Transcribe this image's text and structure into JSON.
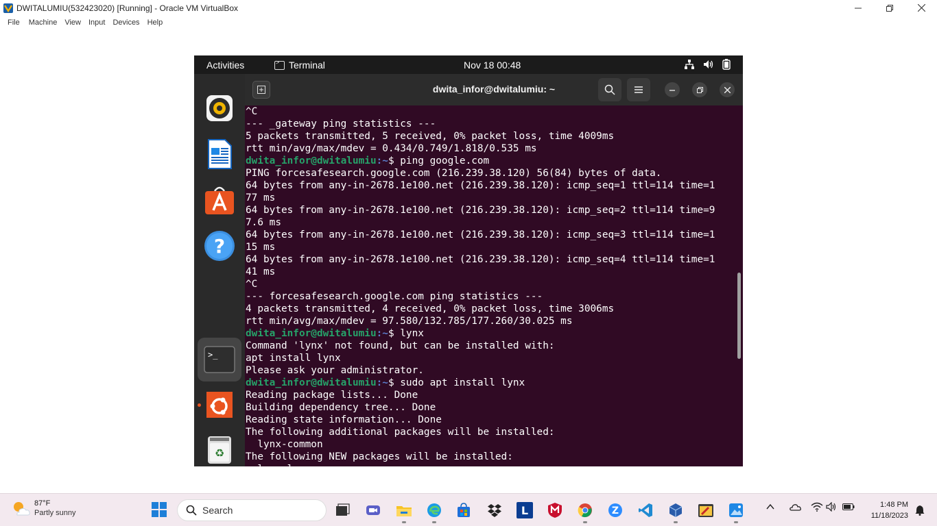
{
  "vbox": {
    "title": "DWITALUMIU(532423020) [Running] - Oracle VM VirtualBox",
    "menus": [
      "File",
      "Machine",
      "View",
      "Input",
      "Devices",
      "Help"
    ]
  },
  "guest": {
    "topbar": {
      "activities": "Activities",
      "app_name": "Terminal",
      "clock": "Nov 18  00:48"
    },
    "terminal": {
      "title": "dwita_infor@dwitalumiu: ~",
      "lines": [
        {
          "text": "^C"
        },
        {
          "text": "--- _gateway ping statistics ---"
        },
        {
          "text": "5 packets transmitted, 5 received, 0% packet loss, time 4009ms"
        },
        {
          "text": "rtt min/avg/max/mdev = 0.434/0.749/1.818/0.535 ms"
        },
        {
          "user": "dwita_infor@dwitalumiu",
          "path": ":~",
          "cmd": "$ ping google.com"
        },
        {
          "text": "PING forcesafesearch.google.com (216.239.38.120) 56(84) bytes of data."
        },
        {
          "text": "64 bytes from any-in-2678.1e100.net (216.239.38.120): icmp_seq=1 ttl=114 time=1"
        },
        {
          "text": "77 ms"
        },
        {
          "text": "64 bytes from any-in-2678.1e100.net (216.239.38.120): icmp_seq=2 ttl=114 time=9"
        },
        {
          "text": "7.6 ms"
        },
        {
          "text": "64 bytes from any-in-2678.1e100.net (216.239.38.120): icmp_seq=3 ttl=114 time=1"
        },
        {
          "text": "15 ms"
        },
        {
          "text": "64 bytes from any-in-2678.1e100.net (216.239.38.120): icmp_seq=4 ttl=114 time=1"
        },
        {
          "text": "41 ms"
        },
        {
          "text": "^C"
        },
        {
          "text": "--- forcesafesearch.google.com ping statistics ---"
        },
        {
          "text": "4 packets transmitted, 4 received, 0% packet loss, time 3006ms"
        },
        {
          "text": "rtt min/avg/max/mdev = 97.580/132.785/177.260/30.025 ms"
        },
        {
          "user": "dwita_infor@dwitalumiu",
          "path": ":~",
          "cmd": "$ lynx"
        },
        {
          "text": "Command 'lynx' not found, but can be installed with:"
        },
        {
          "text": "apt install lynx"
        },
        {
          "text": "Please ask your administrator."
        },
        {
          "user": "dwita_infor@dwitalumiu",
          "path": ":~",
          "cmd": "$ sudo apt install lynx"
        },
        {
          "text": "Reading package lists... Done"
        },
        {
          "text": "Building dependency tree... Done"
        },
        {
          "text": "Reading state information... Done"
        },
        {
          "text": "The following additional packages will be installed:"
        },
        {
          "text": "  lynx-common"
        },
        {
          "text": "The following NEW packages will be installed:"
        },
        {
          "text": "  lynx lynx-common"
        }
      ]
    }
  },
  "taskbar": {
    "weather_temp": "87°F",
    "weather_desc": "Partly sunny",
    "search_label": "Search",
    "time": "1:48 PM",
    "date": "11/18/2023"
  },
  "colors": {
    "terminal_bg": "#300a24",
    "prompt_user": "#26a269",
    "prompt_path": "#5c7fce",
    "ubuntu_orange": "#e95420"
  }
}
